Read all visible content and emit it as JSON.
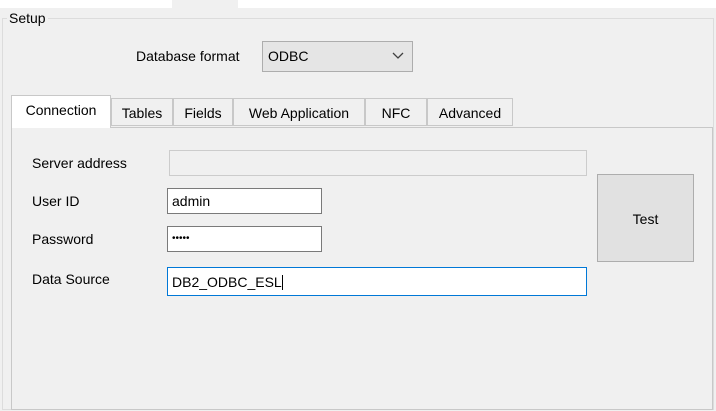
{
  "setup": {
    "group_label": "Setup",
    "database_format_label": "Database format",
    "database_format_value": "ODBC",
    "dropdown_icon": "chevron-down-icon"
  },
  "tabs": [
    {
      "label": "Connection",
      "active": true
    },
    {
      "label": "Tables",
      "active": false
    },
    {
      "label": "Fields",
      "active": false
    },
    {
      "label": "Web Application",
      "active": false
    },
    {
      "label": "NFC",
      "active": false
    },
    {
      "label": "Advanced",
      "active": false
    }
  ],
  "connection": {
    "server_address_label": "Server address",
    "server_address_value": "",
    "user_id_label": "User ID",
    "user_id_value": "admin",
    "password_label": "Password",
    "password_value": "•••••",
    "data_source_label": "Data Source",
    "data_source_value": "DB2_ODBC_ESL",
    "test_button_label": "Test"
  },
  "colors": {
    "window_background": "#f0f0f0",
    "focus_border": "#0078d7"
  }
}
